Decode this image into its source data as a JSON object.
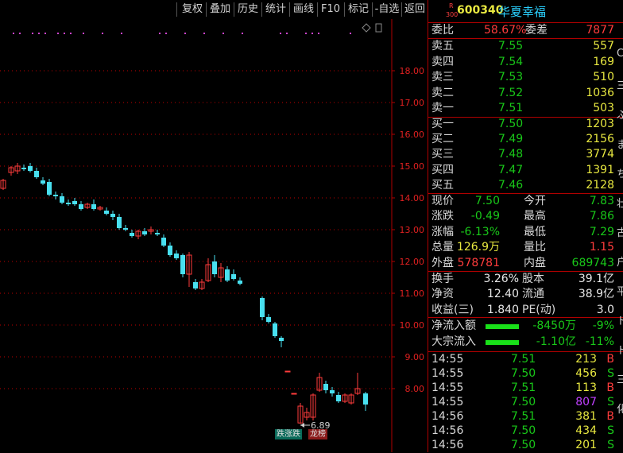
{
  "toolbar": {
    "buttons": [
      "复权",
      "叠加",
      "历史",
      "统计",
      "画线",
      "F10",
      "标记",
      "-自选",
      "返回"
    ]
  },
  "chart": {
    "y_ticks": [
      "18.00",
      "17.00",
      "16.00",
      "15.00",
      "14.00",
      "13.00",
      "12.00",
      "11.00",
      "10.00",
      "9.00",
      "8.00"
    ],
    "low_marker": "6.89",
    "tag_limit_down": "跌涨跌",
    "tag_list": "龙榜"
  },
  "chart_data": {
    "type": "candlestick",
    "y_axis_ticks": [
      18,
      17,
      16,
      15,
      14,
      13,
      12,
      11,
      10,
      9,
      8
    ],
    "candles": [
      {
        "o": 14.3,
        "h": 14.6,
        "l": 14.25,
        "c": 14.55
      },
      {
        "o": 14.8,
        "h": 15.0,
        "l": 14.7,
        "c": 14.95
      },
      {
        "o": 14.85,
        "h": 15.1,
        "l": 14.75,
        "c": 15.0
      },
      {
        "o": 14.95,
        "h": 15.05,
        "l": 14.85,
        "c": 14.9
      },
      {
        "o": 15.0,
        "h": 15.1,
        "l": 14.8,
        "c": 14.85
      },
      {
        "o": 14.85,
        "h": 14.95,
        "l": 14.6,
        "c": 14.65
      },
      {
        "o": 14.55,
        "h": 14.65,
        "l": 14.4,
        "c": 14.45
      },
      {
        "o": 14.5,
        "h": 14.6,
        "l": 14.05,
        "c": 14.1
      },
      {
        "o": 14.1,
        "h": 14.2,
        "l": 13.95,
        "c": 14.05
      },
      {
        "o": 14.05,
        "h": 14.15,
        "l": 13.8,
        "c": 13.85
      },
      {
        "o": 13.85,
        "h": 13.95,
        "l": 13.75,
        "c": 13.8
      },
      {
        "o": 13.9,
        "h": 14.0,
        "l": 13.75,
        "c": 13.8
      },
      {
        "o": 13.8,
        "h": 13.9,
        "l": 13.6,
        "c": 13.65
      },
      {
        "o": 13.7,
        "h": 13.85,
        "l": 13.65,
        "c": 13.8
      },
      {
        "o": 13.8,
        "h": 13.95,
        "l": 13.6,
        "c": 13.65
      },
      {
        "o": 13.65,
        "h": 13.75,
        "l": 13.6,
        "c": 13.7
      },
      {
        "o": 13.6,
        "h": 13.7,
        "l": 13.45,
        "c": 13.5
      },
      {
        "o": 13.5,
        "h": 13.6,
        "l": 13.3,
        "c": 13.4
      },
      {
        "o": 13.4,
        "h": 13.5,
        "l": 13.0,
        "c": 13.05
      },
      {
        "o": 13.05,
        "h": 13.15,
        "l": 12.95,
        "c": 13.0
      },
      {
        "o": 12.9,
        "h": 13.0,
        "l": 12.75,
        "c": 12.8
      },
      {
        "o": 12.8,
        "h": 13.0,
        "l": 12.7,
        "c": 12.95
      },
      {
        "o": 12.95,
        "h": 13.05,
        "l": 12.8,
        "c": 12.85
      },
      {
        "o": 12.95,
        "h": 13.1,
        "l": 12.85,
        "c": 13.0
      },
      {
        "o": 12.9,
        "h": 13.0,
        "l": 12.8,
        "c": 12.85
      },
      {
        "o": 12.75,
        "h": 12.85,
        "l": 12.45,
        "c": 12.5
      },
      {
        "o": 12.5,
        "h": 12.6,
        "l": 12.15,
        "c": 12.2
      },
      {
        "o": 12.25,
        "h": 12.35,
        "l": 12.05,
        "c": 12.1
      },
      {
        "o": 12.2,
        "h": 12.25,
        "l": 11.5,
        "c": 11.6
      },
      {
        "o": 11.6,
        "h": 12.3,
        "l": 11.2,
        "c": 12.2
      },
      {
        "o": 11.35,
        "h": 11.45,
        "l": 11.1,
        "c": 11.15
      },
      {
        "o": 11.15,
        "h": 11.45,
        "l": 11.1,
        "c": 11.35
      },
      {
        "o": 11.4,
        "h": 12.1,
        "l": 11.35,
        "c": 11.9
      },
      {
        "o": 12.0,
        "h": 12.2,
        "l": 11.5,
        "c": 11.6
      },
      {
        "o": 11.5,
        "h": 11.95,
        "l": 11.35,
        "c": 11.8
      },
      {
        "o": 11.75,
        "h": 11.85,
        "l": 11.35,
        "c": 11.4
      },
      {
        "o": 11.6,
        "h": 11.75,
        "l": 11.4,
        "c": 11.45
      },
      {
        "o": 11.4,
        "h": 11.5,
        "l": 11.25,
        "c": 11.3
      },
      {
        "o": 10.85,
        "h": 10.9,
        "l": 10.15,
        "c": 10.25
      },
      {
        "o": 10.25,
        "h": 10.35,
        "l": 10.05,
        "c": 10.1
      },
      {
        "o": 10.05,
        "h": 10.1,
        "l": 9.6,
        "c": 9.65
      },
      {
        "o": 9.6,
        "h": 9.65,
        "l": 9.3,
        "c": 9.5
      },
      {
        "o": 8.55,
        "h": 8.55,
        "l": 8.55,
        "c": 8.55
      },
      {
        "o": 7.85,
        "h": 7.85,
        "l": 7.85,
        "c": 7.85
      },
      {
        "o": 6.92,
        "h": 7.55,
        "l": 6.89,
        "c": 7.45
      },
      {
        "o": 7.1,
        "h": 7.4,
        "l": 7.0,
        "c": 7.25
      },
      {
        "o": 7.1,
        "h": 7.85,
        "l": 7.0,
        "c": 7.8
      },
      {
        "o": 7.95,
        "h": 8.5,
        "l": 7.9,
        "c": 8.35
      },
      {
        "o": 8.15,
        "h": 8.25,
        "l": 7.85,
        "c": 7.95
      },
      {
        "o": 7.95,
        "h": 8.05,
        "l": 7.75,
        "c": 7.85
      },
      {
        "o": 7.8,
        "h": 7.9,
        "l": 7.55,
        "c": 7.6
      },
      {
        "o": 7.6,
        "h": 7.85,
        "l": 7.55,
        "c": 7.8
      },
      {
        "o": 7.55,
        "h": 7.85,
        "l": 7.5,
        "c": 7.8
      },
      {
        "o": 7.85,
        "h": 8.5,
        "l": 7.8,
        "c": 8.0
      },
      {
        "o": 7.85,
        "h": 7.9,
        "l": 7.3,
        "c": 7.5
      }
    ]
  },
  "quote": {
    "badge_r": "R",
    "badge_300": "300",
    "code": "600340",
    "name": "华夏幸福",
    "weibi_label": "委比",
    "weibi_value": "58.67%",
    "weicha_label": "委差",
    "weicha_value": "7877",
    "asks": [
      {
        "label": "卖五",
        "price": "7.55",
        "vol": "557"
      },
      {
        "label": "卖四",
        "price": "7.54",
        "vol": "169"
      },
      {
        "label": "卖三",
        "price": "7.53",
        "vol": "510"
      },
      {
        "label": "卖二",
        "price": "7.52",
        "vol": "1036"
      },
      {
        "label": "卖一",
        "price": "7.51",
        "vol": "503"
      }
    ],
    "bids": [
      {
        "label": "买一",
        "price": "7.50",
        "vol": "1203"
      },
      {
        "label": "买二",
        "price": "7.49",
        "vol": "2156"
      },
      {
        "label": "买三",
        "price": "7.48",
        "vol": "3774"
      },
      {
        "label": "买四",
        "price": "7.47",
        "vol": "1391"
      },
      {
        "label": "买五",
        "price": "7.46",
        "vol": "2128"
      }
    ],
    "stats": [
      {
        "l1": "现价",
        "v1": "7.50",
        "c1": "green",
        "l2": "今开",
        "v2": "7.83",
        "c2": "green"
      },
      {
        "l1": "涨跌",
        "v1": "-0.49",
        "c1": "green",
        "l2": "最高",
        "v2": "7.86",
        "c2": "green"
      },
      {
        "l1": "涨幅",
        "v1": "-6.13%",
        "c1": "green",
        "l2": "最低",
        "v2": "7.29",
        "c2": "green"
      },
      {
        "l1": "总量",
        "v1": "126.9万",
        "c1": "yellow",
        "l2": "量比",
        "v2": "1.15",
        "c2": "red"
      },
      {
        "l1": "外盘",
        "v1": "578781",
        "c1": "red",
        "l2": "内盘",
        "v2": "689743",
        "c2": "green"
      }
    ],
    "stats2": [
      {
        "l1": "换手",
        "v1": "3.26%",
        "l2": "股本",
        "v2": "39.1亿"
      },
      {
        "l1": "净资",
        "v1": "12.40",
        "l2": "流通",
        "v2": "38.9亿"
      },
      {
        "l1": "收益(三)",
        "v1": "1.840",
        "l2": "PE(动)",
        "v2": "3.0"
      }
    ],
    "flows": [
      {
        "label": "净流入额",
        "amount": "-8450万",
        "pct": "-9%"
      },
      {
        "label": "大宗流入",
        "amount": "-1.10亿",
        "pct": "-11%"
      }
    ],
    "ticks": [
      {
        "time": "14:55",
        "price": "7.51",
        "vol": "213",
        "side": "B",
        "vcolor": "yellow"
      },
      {
        "time": "14:55",
        "price": "7.50",
        "vol": "456",
        "side": "S",
        "vcolor": "yellow"
      },
      {
        "time": "14:55",
        "price": "7.51",
        "vol": "113",
        "side": "B",
        "vcolor": "yellow"
      },
      {
        "time": "14:55",
        "price": "7.50",
        "vol": "807",
        "side": "S",
        "vcolor": "purple"
      },
      {
        "time": "14:56",
        "price": "7.51",
        "vol": "381",
        "side": "B",
        "vcolor": "yellow"
      },
      {
        "time": "14:56",
        "price": "7.50",
        "vol": "434",
        "side": "S",
        "vcolor": "yellow"
      },
      {
        "time": "14:56",
        "price": "7.50",
        "vol": "201",
        "side": "S",
        "vcolor": "yellow"
      }
    ],
    "edge_chars": [
      "C",
      "三",
      "ぶ",
      "ま",
      "ち",
      "壮",
      "古",
      "户",
      "平",
      "ト",
      "ト",
      "三",
      "化"
    ]
  }
}
